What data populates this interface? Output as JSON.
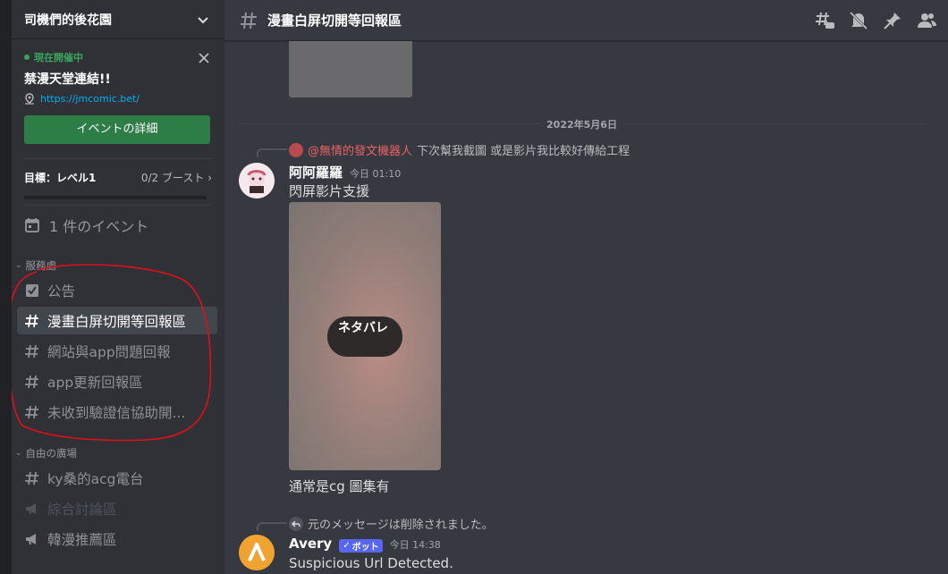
{
  "server": {
    "name": "司機們的後花園"
  },
  "event": {
    "status": "現在開催中",
    "title": "禁漫天堂連結!!",
    "link": "https://jmcomic.bet/",
    "button": "イベントの詳細"
  },
  "boost": {
    "goal": "目標：レベル1",
    "count": "0/2 ブースト",
    "progress": 0
  },
  "events_row": {
    "label": "1 件のイベント"
  },
  "categories": [
    {
      "name": "服務處",
      "channels": [
        {
          "name": "公告",
          "type": "announcement"
        },
        {
          "name": "漫畫白屏切開等回報區",
          "type": "text",
          "active": true
        },
        {
          "name": "網站與app問題回報",
          "type": "text"
        },
        {
          "name": "app更新回報區",
          "type": "text"
        },
        {
          "name": "未收到驗證信協助開...",
          "type": "text"
        }
      ]
    },
    {
      "name": "自由の廣場",
      "channels": [
        {
          "name": "ky桑的acg電台",
          "type": "text"
        },
        {
          "name": "綜合討論區",
          "type": "announcement",
          "muted": true
        },
        {
          "name": "韓漫推薦區",
          "type": "announcement"
        }
      ]
    }
  ],
  "channel_header": {
    "title": "漫畫白屏切開等回報區"
  },
  "chat": {
    "date_divider": "2022年5月6日",
    "messages": [
      {
        "reply_to_author": "@無情的發文機器人",
        "reply_to_text": "下次幫我截圖 或是影片我比較好傳給工程",
        "author": "阿阿羅羅",
        "time": "今日 01:10",
        "text": "閃屏影片支援",
        "spoiler_label": "ネタバレ",
        "caption": "通常是cg 圖集有"
      },
      {
        "reply_notice": "元のメッセージは削除されました。",
        "author": "Avery",
        "bot_tag": "ボット",
        "time": "今日 14:38",
        "text": "Suspicious Url Detected."
      }
    ]
  },
  "colors": {
    "accent_green": "#2d7d46",
    "link": "#00aff4",
    "bot_tag": "#5865f2",
    "annotation_red": "#e0101a"
  }
}
